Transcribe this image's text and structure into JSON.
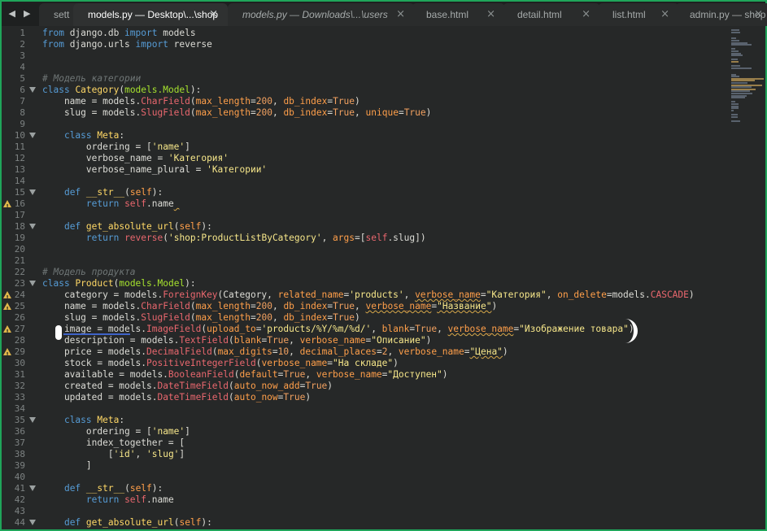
{
  "nav": {
    "back_icon": "chevron-left-icon",
    "forward_icon": "chevron-right-icon",
    "back": "◀",
    "forward": "▶"
  },
  "tabs": [
    {
      "label": "sett",
      "active": false,
      "italic": false
    },
    {
      "label": "models.py — Desktop\\...\\shop",
      "active": true,
      "italic": false
    },
    {
      "label": "models.py — Downloads\\...\\users",
      "active": false,
      "italic": true
    },
    {
      "label": "base.html",
      "active": false,
      "italic": false
    },
    {
      "label": "detail.html",
      "active": false,
      "italic": false
    },
    {
      "label": "list.html",
      "active": false,
      "italic": false
    },
    {
      "label": "admin.py — shop",
      "active": false,
      "italic": false
    }
  ],
  "close_glyph": "×",
  "code_lines": [
    {
      "n": "1",
      "fold": false,
      "warn": false,
      "tokens": [
        [
          "kw",
          "from"
        ],
        [
          "plain",
          " django.db "
        ],
        [
          "kw",
          "import"
        ],
        [
          "plain",
          " models"
        ]
      ]
    },
    {
      "n": "2",
      "fold": false,
      "warn": false,
      "tokens": [
        [
          "kw",
          "from"
        ],
        [
          "plain",
          " django.urls "
        ],
        [
          "kw",
          "import"
        ],
        [
          "plain",
          " reverse"
        ]
      ]
    },
    {
      "n": "3",
      "fold": false,
      "warn": false,
      "tokens": []
    },
    {
      "n": "4",
      "fold": false,
      "warn": false,
      "tokens": []
    },
    {
      "n": "5",
      "fold": false,
      "warn": false,
      "tokens": [
        [
          "cm",
          "# Модель категории"
        ]
      ]
    },
    {
      "n": "6",
      "fold": true,
      "warn": false,
      "tokens": [
        [
          "kw",
          "class"
        ],
        [
          "plain",
          " "
        ],
        [
          "cls",
          "Category"
        ],
        [
          "plain",
          "("
        ],
        [
          "df",
          "models.Model"
        ],
        [
          "plain",
          "):"
        ]
      ]
    },
    {
      "n": "7",
      "fold": false,
      "warn": false,
      "tokens": [
        [
          "plain",
          "    name = models."
        ],
        [
          "call",
          "CharField"
        ],
        [
          "plain",
          "("
        ],
        [
          "arg",
          "max_length"
        ],
        [
          "plain",
          "="
        ],
        [
          "cst",
          "200"
        ],
        [
          "plain",
          ", "
        ],
        [
          "arg",
          "db_index"
        ],
        [
          "plain",
          "="
        ],
        [
          "cst",
          "True"
        ],
        [
          "plain",
          ")"
        ]
      ]
    },
    {
      "n": "8",
      "fold": false,
      "warn": false,
      "tokens": [
        [
          "plain",
          "    slug = models."
        ],
        [
          "call",
          "SlugField"
        ],
        [
          "plain",
          "("
        ],
        [
          "arg",
          "max_length"
        ],
        [
          "plain",
          "="
        ],
        [
          "cst",
          "200"
        ],
        [
          "plain",
          ", "
        ],
        [
          "arg",
          "db_index"
        ],
        [
          "plain",
          "="
        ],
        [
          "cst",
          "True"
        ],
        [
          "plain",
          ", "
        ],
        [
          "arg",
          "unique"
        ],
        [
          "plain",
          "="
        ],
        [
          "cst",
          "True"
        ],
        [
          "plain",
          ")"
        ]
      ]
    },
    {
      "n": "9",
      "fold": false,
      "warn": false,
      "tokens": []
    },
    {
      "n": "10",
      "fold": true,
      "warn": false,
      "tokens": [
        [
          "plain",
          "    "
        ],
        [
          "kw",
          "class"
        ],
        [
          "plain",
          " "
        ],
        [
          "cls",
          "Meta"
        ],
        [
          "plain",
          ":"
        ]
      ]
    },
    {
      "n": "11",
      "fold": false,
      "warn": false,
      "tokens": [
        [
          "plain",
          "        ordering = ["
        ],
        [
          "str",
          "'name'"
        ],
        [
          "plain",
          "]"
        ]
      ]
    },
    {
      "n": "12",
      "fold": false,
      "warn": false,
      "tokens": [
        [
          "plain",
          "        verbose_name = "
        ],
        [
          "str",
          "'Категория'"
        ]
      ]
    },
    {
      "n": "13",
      "fold": false,
      "warn": false,
      "tokens": [
        [
          "plain",
          "        verbose_name_plural = "
        ],
        [
          "str",
          "'Категории'"
        ]
      ]
    },
    {
      "n": "14",
      "fold": false,
      "warn": false,
      "tokens": []
    },
    {
      "n": "15",
      "fold": true,
      "warn": false,
      "tokens": [
        [
          "plain",
          "    "
        ],
        [
          "kw",
          "def"
        ],
        [
          "plain",
          " "
        ],
        [
          "fn",
          "__str__"
        ],
        [
          "plain",
          "("
        ],
        [
          "arg",
          "self"
        ],
        [
          "plain",
          "):"
        ]
      ]
    },
    {
      "n": "16",
      "fold": false,
      "warn": true,
      "tokens": [
        [
          "plain",
          "        "
        ],
        [
          "kw",
          "return"
        ],
        [
          "plain",
          " "
        ],
        [
          "slf",
          "self"
        ],
        [
          "plain",
          ".name"
        ],
        [
          "sq",
          " "
        ]
      ]
    },
    {
      "n": "17",
      "fold": false,
      "warn": false,
      "tokens": []
    },
    {
      "n": "18",
      "fold": true,
      "warn": false,
      "tokens": [
        [
          "plain",
          "    "
        ],
        [
          "kw",
          "def"
        ],
        [
          "plain",
          " "
        ],
        [
          "fn",
          "get_absolute_url"
        ],
        [
          "plain",
          "("
        ],
        [
          "arg",
          "self"
        ],
        [
          "plain",
          "):"
        ]
      ]
    },
    {
      "n": "19",
      "fold": false,
      "warn": false,
      "tokens": [
        [
          "plain",
          "        "
        ],
        [
          "kw",
          "return"
        ],
        [
          "plain",
          " "
        ],
        [
          "call",
          "reverse"
        ],
        [
          "plain",
          "("
        ],
        [
          "str",
          "'shop:ProductListByCategory'"
        ],
        [
          "plain",
          ", "
        ],
        [
          "arg",
          "args"
        ],
        [
          "plain",
          "=["
        ],
        [
          "slf",
          "self"
        ],
        [
          "plain",
          ".slug])"
        ]
      ]
    },
    {
      "n": "20",
      "fold": false,
      "warn": false,
      "tokens": []
    },
    {
      "n": "21",
      "fold": false,
      "warn": false,
      "tokens": []
    },
    {
      "n": "22",
      "fold": false,
      "warn": false,
      "tokens": [
        [
          "cm",
          "# Модель продукта"
        ]
      ]
    },
    {
      "n": "23",
      "fold": true,
      "warn": false,
      "tokens": [
        [
          "kw",
          "class"
        ],
        [
          "plain",
          " "
        ],
        [
          "cls",
          "Product"
        ],
        [
          "plain",
          "("
        ],
        [
          "df",
          "models.Model"
        ],
        [
          "plain",
          "):"
        ]
      ]
    },
    {
      "n": "24",
      "fold": false,
      "warn": true,
      "tokens": [
        [
          "plain",
          "    category = models."
        ],
        [
          "call",
          "ForeignKey"
        ],
        [
          "plain",
          "(Category, "
        ],
        [
          "arg",
          "related_name"
        ],
        [
          "plain",
          "="
        ],
        [
          "str",
          "'products'"
        ],
        [
          "plain",
          ", "
        ],
        [
          "arg",
          "verbose_name"
        ],
        [
          "plain",
          "="
        ],
        [
          "str",
          "\"Категория\""
        ],
        [
          "plain",
          ", "
        ],
        [
          "arg",
          "on_delete"
        ],
        [
          "plain",
          "=models."
        ],
        [
          "call",
          "CASCADE"
        ],
        [
          "plain",
          ")"
        ]
      ]
    },
    {
      "n": "25",
      "fold": false,
      "warn": true,
      "tokens": [
        [
          "plain",
          "    name = models."
        ],
        [
          "call",
          "CharField"
        ],
        [
          "plain",
          "("
        ],
        [
          "arg",
          "max_length"
        ],
        [
          "plain",
          "="
        ],
        [
          "cst",
          "200"
        ],
        [
          "plain",
          ", "
        ],
        [
          "arg",
          "db_index"
        ],
        [
          "plain",
          "="
        ],
        [
          "cst",
          "True"
        ],
        [
          "plain",
          ", "
        ],
        [
          "arg",
          "verbose_name"
        ],
        [
          "plain",
          "="
        ],
        [
          "str",
          "\"Название\""
        ],
        [
          "plain",
          ")"
        ]
      ]
    },
    {
      "n": "26",
      "fold": false,
      "warn": false,
      "tokens": [
        [
          "plain",
          "    slug = models."
        ],
        [
          "call",
          "SlugField"
        ],
        [
          "plain",
          "("
        ],
        [
          "arg",
          "max_length"
        ],
        [
          "plain",
          "="
        ],
        [
          "cst",
          "200"
        ],
        [
          "plain",
          ", "
        ],
        [
          "arg",
          "db_index"
        ],
        [
          "plain",
          "="
        ],
        [
          "cst",
          "True"
        ],
        [
          "plain",
          ")"
        ]
      ]
    },
    {
      "n": "27",
      "fold": false,
      "warn": true,
      "tokens": [
        [
          "plain",
          "    image = models."
        ],
        [
          "call",
          "ImageField"
        ],
        [
          "plain",
          "("
        ],
        [
          "arg",
          "upload_to"
        ],
        [
          "plain",
          "="
        ],
        [
          "str",
          "'products/%Y/%m/%d/'"
        ],
        [
          "plain",
          ", "
        ],
        [
          "arg",
          "blank"
        ],
        [
          "plain",
          "="
        ],
        [
          "cst",
          "True"
        ],
        [
          "plain",
          ", "
        ],
        [
          "arg",
          "verbose_name"
        ],
        [
          "plain",
          "="
        ],
        [
          "str",
          "\"Изображение товара\""
        ],
        [
          "plain",
          ")"
        ]
      ]
    },
    {
      "n": "28",
      "fold": false,
      "warn": false,
      "tokens": [
        [
          "plain",
          "    description = models."
        ],
        [
          "call",
          "TextField"
        ],
        [
          "plain",
          "("
        ],
        [
          "arg",
          "blank"
        ],
        [
          "plain",
          "="
        ],
        [
          "cst",
          "True"
        ],
        [
          "plain",
          ", "
        ],
        [
          "arg",
          "verbose_name"
        ],
        [
          "plain",
          "="
        ],
        [
          "str",
          "\"Описание\""
        ],
        [
          "plain",
          ")"
        ]
      ]
    },
    {
      "n": "29",
      "fold": false,
      "warn": true,
      "tokens": [
        [
          "plain",
          "    price = models."
        ],
        [
          "call",
          "DecimalField"
        ],
        [
          "plain",
          "("
        ],
        [
          "arg",
          "max_digits"
        ],
        [
          "plain",
          "="
        ],
        [
          "cst",
          "10"
        ],
        [
          "plain",
          ", "
        ],
        [
          "arg",
          "decimal_places"
        ],
        [
          "plain",
          "="
        ],
        [
          "cst",
          "2"
        ],
        [
          "plain",
          ", "
        ],
        [
          "arg",
          "verbose_name"
        ],
        [
          "plain",
          "="
        ],
        [
          "str",
          "\"Цена\""
        ],
        [
          "plain",
          ")"
        ]
      ]
    },
    {
      "n": "30",
      "fold": false,
      "warn": false,
      "tokens": [
        [
          "plain",
          "    stock = models."
        ],
        [
          "call",
          "PositiveIntegerField"
        ],
        [
          "plain",
          "("
        ],
        [
          "arg",
          "verbose_name"
        ],
        [
          "plain",
          "="
        ],
        [
          "str",
          "\"На складе\""
        ],
        [
          "plain",
          ")"
        ]
      ]
    },
    {
      "n": "31",
      "fold": false,
      "warn": false,
      "tokens": [
        [
          "plain",
          "    available = models."
        ],
        [
          "call",
          "BooleanField"
        ],
        [
          "plain",
          "("
        ],
        [
          "arg",
          "default"
        ],
        [
          "plain",
          "="
        ],
        [
          "cst",
          "True"
        ],
        [
          "plain",
          ", "
        ],
        [
          "arg",
          "verbose_name"
        ],
        [
          "plain",
          "="
        ],
        [
          "str",
          "\"Доступен\""
        ],
        [
          "plain",
          ")"
        ]
      ]
    },
    {
      "n": "32",
      "fold": false,
      "warn": false,
      "tokens": [
        [
          "plain",
          "    created = models."
        ],
        [
          "call",
          "DateTimeField"
        ],
        [
          "plain",
          "("
        ],
        [
          "arg",
          "auto_now_add"
        ],
        [
          "plain",
          "="
        ],
        [
          "cst",
          "True"
        ],
        [
          "plain",
          ")"
        ]
      ]
    },
    {
      "n": "33",
      "fold": false,
      "warn": false,
      "tokens": [
        [
          "plain",
          "    updated = models."
        ],
        [
          "call",
          "DateTimeField"
        ],
        [
          "plain",
          "("
        ],
        [
          "arg",
          "auto_now"
        ],
        [
          "plain",
          "="
        ],
        [
          "cst",
          "True"
        ],
        [
          "plain",
          ")"
        ]
      ]
    },
    {
      "n": "34",
      "fold": false,
      "warn": false,
      "tokens": []
    },
    {
      "n": "35",
      "fold": true,
      "warn": false,
      "tokens": [
        [
          "plain",
          "    "
        ],
        [
          "kw",
          "class"
        ],
        [
          "plain",
          " "
        ],
        [
          "cls",
          "Meta"
        ],
        [
          "plain",
          ":"
        ]
      ]
    },
    {
      "n": "36",
      "fold": false,
      "warn": false,
      "tokens": [
        [
          "plain",
          "        ordering = ["
        ],
        [
          "str",
          "'name'"
        ],
        [
          "plain",
          "]"
        ]
      ]
    },
    {
      "n": "37",
      "fold": false,
      "warn": false,
      "tokens": [
        [
          "plain",
          "        index_together = ["
        ]
      ]
    },
    {
      "n": "38",
      "fold": false,
      "warn": false,
      "tokens": [
        [
          "plain",
          "            ["
        ],
        [
          "str",
          "'id'"
        ],
        [
          "plain",
          ", "
        ],
        [
          "str",
          "'slug'"
        ],
        [
          "plain",
          "]"
        ]
      ]
    },
    {
      "n": "39",
      "fold": false,
      "warn": false,
      "tokens": [
        [
          "plain",
          "        ]"
        ]
      ]
    },
    {
      "n": "40",
      "fold": false,
      "warn": false,
      "tokens": []
    },
    {
      "n": "41",
      "fold": true,
      "warn": false,
      "tokens": [
        [
          "plain",
          "    "
        ],
        [
          "kw",
          "def"
        ],
        [
          "plain",
          " "
        ],
        [
          "fn",
          "__str__"
        ],
        [
          "plain",
          "("
        ],
        [
          "arg",
          "self"
        ],
        [
          "plain",
          "):"
        ]
      ]
    },
    {
      "n": "42",
      "fold": false,
      "warn": false,
      "tokens": [
        [
          "plain",
          "        "
        ],
        [
          "kw",
          "return"
        ],
        [
          "plain",
          " "
        ],
        [
          "slf",
          "self"
        ],
        [
          "plain",
          ".name"
        ]
      ]
    },
    {
      "n": "43",
      "fold": false,
      "warn": false,
      "tokens": []
    },
    {
      "n": "44",
      "fold": true,
      "warn": false,
      "tokens": [
        [
          "plain",
          "    "
        ],
        [
          "kw",
          "def"
        ],
        [
          "plain",
          " "
        ],
        [
          "fn",
          "get_absolute_url"
        ],
        [
          "plain",
          "("
        ],
        [
          "arg",
          "self"
        ],
        [
          "plain",
          "):"
        ]
      ]
    }
  ],
  "colors": {
    "background": "#262828",
    "tabbar": "#1e2020",
    "frame": "#1fa55a",
    "warning": "#e0b64a"
  }
}
